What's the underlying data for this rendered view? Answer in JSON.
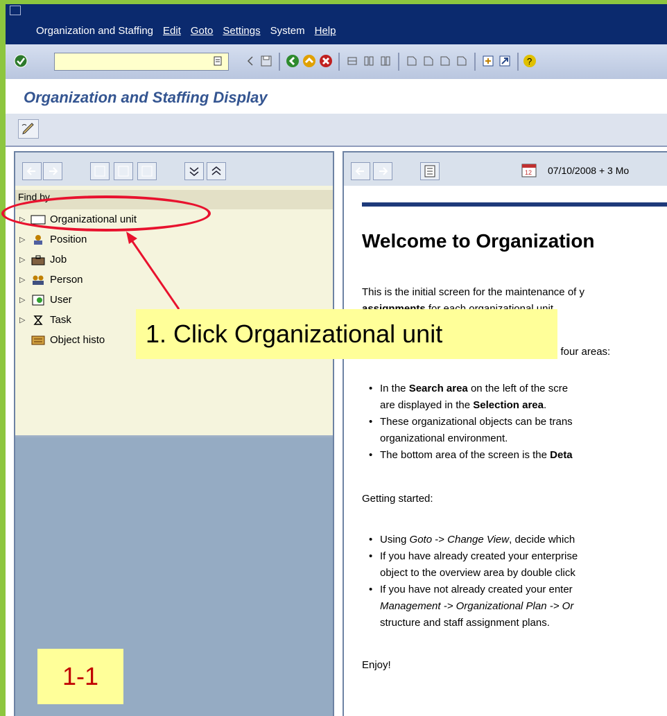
{
  "menu": [
    "Organization and Staffing",
    "Edit",
    "Goto",
    "Settings",
    "System",
    "Help"
  ],
  "window_title": "Organization and Staffing Display",
  "left_pane": {
    "header": "Find by",
    "items": [
      {
        "label": "Organizational unit",
        "icon": "org-unit-icon"
      },
      {
        "label": "Position",
        "icon": "position-icon"
      },
      {
        "label": "Job",
        "icon": "job-icon"
      },
      {
        "label": "Person",
        "icon": "person-icon"
      },
      {
        "label": "User",
        "icon": "user-icon"
      },
      {
        "label": "Task",
        "icon": "task-icon"
      },
      {
        "label": "Object histo",
        "icon": "object-history-icon"
      }
    ]
  },
  "right_pane": {
    "date": "07/10/2008",
    "date_suffix": "+ 3 Mo",
    "welcome": "Welcome to Organization",
    "intro_line1": "This is the initial screen for the maintenance of y",
    "intro_bold": "assignments",
    "intro_line2_rest": " for each organizational unit.",
    "areas_text": "o four areas:",
    "b1a_pre": "In the ",
    "b1a_bold": "Search area",
    "b1a_post": " on the left of the scre",
    "b1b_pre": "are displayed in the ",
    "b1b_bold": "Selection area",
    "b1b_post": ".",
    "b2a": "These organizational objects can be trans",
    "b2b": "organizational environment.",
    "b3_pre": "The bottom area of the screen is the ",
    "b3_bold": "Deta",
    "getting_started": "Getting started:",
    "g1_pre": "Using ",
    "g1_it1": "Goto",
    "g1_mid": " -> ",
    "g1_it2": "Change View",
    "g1_post": ", decide which",
    "g2a": "If you have already created your enterprise",
    "g2b": "object to the overview area by double click",
    "g3a": "If you have not already created your enter",
    "g3b": "Management -> Organizational Plan -> Or",
    "g3c": "structure and staff assignment plans.",
    "enjoy": "Enjoy!"
  },
  "callout": "1. Click Organizational unit",
  "step": "1-1",
  "colors": {
    "annotation_red": "#e8122e",
    "callout_bg": "#ffff99",
    "title_blue": "#345591",
    "menu_bg": "#0b2a6e"
  }
}
